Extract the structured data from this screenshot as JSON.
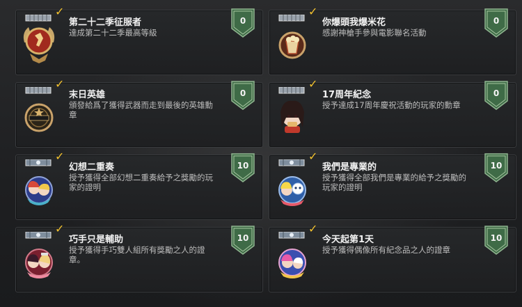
{
  "achievements": [
    {
      "title": "第二十二季征服者",
      "description": "達成第二十二季最高等級",
      "points": "0",
      "completed": true
    },
    {
      "title": "你爆頭我爆米花",
      "description": "感謝神槍手參與電影聯名活動",
      "points": "0",
      "completed": true
    },
    {
      "title": "末日英雄",
      "description": "頒發給爲了獲得武器而走到最後的英雄勳章",
      "points": "0",
      "completed": true
    },
    {
      "title": "17周年紀念",
      "description": "授予達成17周年慶祝活動的玩家的勳章",
      "points": "0",
      "completed": true
    },
    {
      "title": "幻想二重奏",
      "description": "授予獲得全部幻想二重奏給予之獎勵的玩家的證明",
      "points": "10",
      "completed": true
    },
    {
      "title": "我們是專業的",
      "description": "授予獲得全部我們是專業的給予之獎勵的玩家的證明",
      "points": "10",
      "completed": true
    },
    {
      "title": "巧手只是輔助",
      "description": "授予獲得手巧雙人組所有獎勵之人的證章。",
      "points": "10",
      "completed": true
    },
    {
      "title": "今天起第1天",
      "description": "授予獲得偶像所有紀念品之人的證章",
      "points": "10",
      "completed": true
    }
  ],
  "colors": {
    "points_shield": "#3f6b47",
    "check": "#f2c12e",
    "title": "#f2f2f2",
    "description": "#bdbdbd"
  },
  "icons": [
    "medal-bar-icon",
    "checkmark-icon",
    "points-shield-icon"
  ]
}
